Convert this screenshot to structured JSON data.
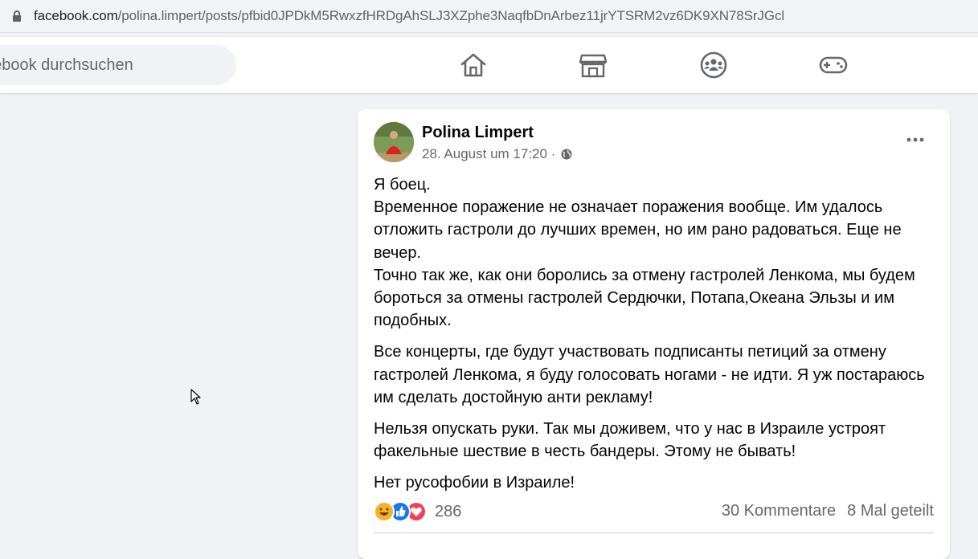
{
  "browser": {
    "url_domain": "facebook.com",
    "url_path": "/polina.limpert/posts/pfbid0JPDkM5RwxzfHRDgAhSLJ3XZphe3NaqfbDnArbez11jrYTSRM2vz6DK9XN78SrJGcl",
    "lock_icon": "lock-icon"
  },
  "header": {
    "search_placeholder": "acebook durchsuchen",
    "nav": [
      {
        "icon": "home-icon"
      },
      {
        "icon": "marketplace-icon"
      },
      {
        "icon": "groups-icon"
      },
      {
        "icon": "gaming-icon"
      }
    ]
  },
  "post": {
    "author": "Polina Limpert",
    "timestamp": "28. August um 17:20 ·",
    "audience_icon": "globe-icon",
    "paragraphs": [
      "Я боец.\nВременное поражение не означает поражения вообще. Им удалось отложить гастроли до лучших времен, но им рано радоваться. Еще не вечер.\nТочно так же, как они боролись за отмену гастролей Ленкома, мы будем бороться за отмены гастролей Сердючки, Потапа,Океана Эльзы и им подобных.",
      "Все концерты, где будут участвовать подписанты петиций за отмену гастролей Ленкома, я буду голосовать ногами - не идти. Я уж постараюсь им сделать достойную анти рекламу!",
      "Нельзя опускать руки. Так мы доживем, что у нас в Израиле устроят факельные шествие в честь бандеры. Этому не бывать!",
      "Нет русофобии в Израиле!"
    ],
    "reactions": {
      "types": [
        "haha",
        "like",
        "love"
      ],
      "count": "286"
    },
    "comments": "30 Kommentare",
    "shares": "8 Mal geteilt"
  }
}
